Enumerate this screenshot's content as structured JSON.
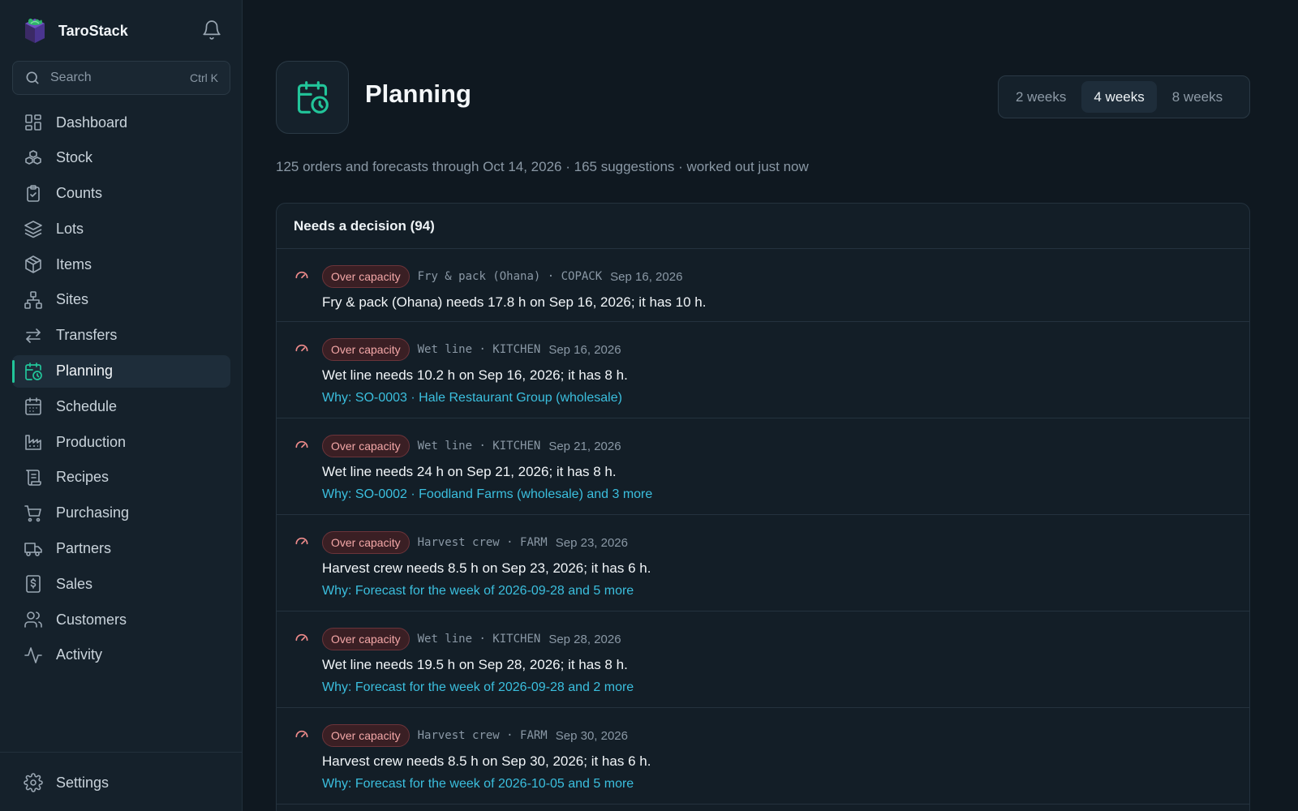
{
  "app": {
    "name": "TaroStack"
  },
  "search": {
    "placeholder": "Search",
    "shortcut": "Ctrl K"
  },
  "sidebar": {
    "items": [
      {
        "label": "Dashboard",
        "icon": "dashboard-icon"
      },
      {
        "label": "Stock",
        "icon": "boxes-icon"
      },
      {
        "label": "Counts",
        "icon": "clipboard-check-icon"
      },
      {
        "label": "Lots",
        "icon": "layers-icon"
      },
      {
        "label": "Items",
        "icon": "package-icon"
      },
      {
        "label": "Sites",
        "icon": "network-icon"
      },
      {
        "label": "Transfers",
        "icon": "arrows-transfer-icon"
      },
      {
        "label": "Planning",
        "icon": "calendar-clock-icon",
        "active": true
      },
      {
        "label": "Schedule",
        "icon": "calendar-icon"
      },
      {
        "label": "Production",
        "icon": "factory-icon"
      },
      {
        "label": "Recipes",
        "icon": "scroll-icon"
      },
      {
        "label": "Purchasing",
        "icon": "cart-icon"
      },
      {
        "label": "Partners",
        "icon": "truck-icon"
      },
      {
        "label": "Sales",
        "icon": "receipt-dollar-icon"
      },
      {
        "label": "Customers",
        "icon": "users-icon"
      },
      {
        "label": "Activity",
        "icon": "activity-icon"
      }
    ],
    "settings": {
      "label": "Settings",
      "icon": "gear-icon"
    }
  },
  "page": {
    "title": "Planning",
    "subtitle": "125 orders and forecasts through Oct 14, 2026 · 165 suggestions · worked out just now",
    "range": {
      "options": [
        "2 weeks",
        "4 weeks",
        "8 weeks"
      ],
      "selected": "4 weeks"
    }
  },
  "decisions": {
    "header": "Needs a decision (94)",
    "rows": [
      {
        "badge": "Over capacity",
        "resource": "Fry & pack (Ohana) · COPACK",
        "date": "Sep 16, 2026",
        "message": "Fry & pack (Ohana) needs 17.8 h on Sep 16, 2026; it has 10 h.",
        "why": ""
      },
      {
        "badge": "Over capacity",
        "resource": "Wet line · KITCHEN",
        "date": "Sep 16, 2026",
        "message": "Wet line needs 10.2 h on Sep 16, 2026; it has 8 h.",
        "why": "Why: SO-0003 · Hale Restaurant Group (wholesale)"
      },
      {
        "badge": "Over capacity",
        "resource": "Wet line · KITCHEN",
        "date": "Sep 21, 2026",
        "message": "Wet line needs 24 h on Sep 21, 2026; it has 8 h.",
        "why": "Why: SO-0002 · Foodland Farms (wholesale) and 3 more"
      },
      {
        "badge": "Over capacity",
        "resource": "Harvest crew · FARM",
        "date": "Sep 23, 2026",
        "message": "Harvest crew needs 8.5 h on Sep 23, 2026; it has 6 h.",
        "why": "Why: Forecast for the week of 2026-09-28 and 5 more"
      },
      {
        "badge": "Over capacity",
        "resource": "Wet line · KITCHEN",
        "date": "Sep 28, 2026",
        "message": "Wet line needs 19.5 h on Sep 28, 2026; it has 8 h.",
        "why": "Why: Forecast for the week of 2026-09-28 and 2 more"
      },
      {
        "badge": "Over capacity",
        "resource": "Harvest crew · FARM",
        "date": "Sep 30, 2026",
        "message": "Harvest crew needs 8.5 h on Sep 30, 2026; it has 6 h.",
        "why": "Why: Forecast for the week of 2026-10-05 and 5 more"
      }
    ]
  },
  "colors": {
    "accent": "#22c59a",
    "link": "#3bbfde",
    "badge_text": "#f3a7a7",
    "background": "#0f1820"
  }
}
